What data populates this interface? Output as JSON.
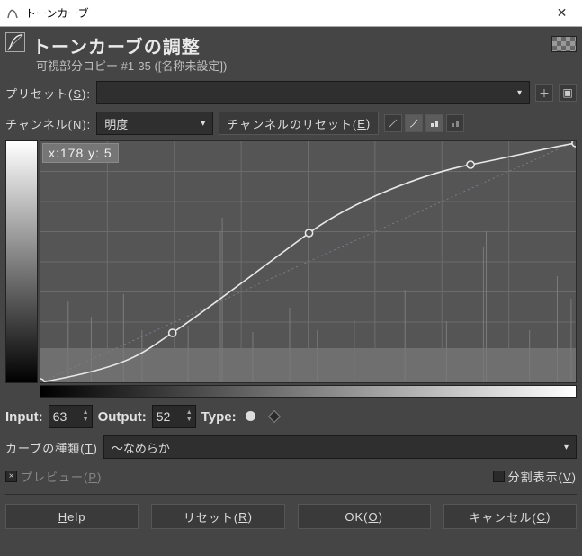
{
  "window": {
    "title": "トーンカーブ"
  },
  "header": {
    "title": "トーンカーブの調整",
    "subtitle": "可視部分コピー  #1-35 ([名称未設定])"
  },
  "preset": {
    "label_pre": "プリセット(",
    "label_u": "S",
    "label_post": "):",
    "value": ""
  },
  "channel": {
    "label_pre": "チャンネル(",
    "label_u": "N",
    "label_post": "):",
    "value": "明度",
    "reset_pre": "チャンネルのリセット(",
    "reset_u": "E",
    "reset_post": ")"
  },
  "curve": {
    "coord_label": "x:178 y:  5"
  },
  "io": {
    "input_label": "Input:",
    "input_value": "63",
    "output_label": "Output:",
    "output_value": "52",
    "type_label": "Type:"
  },
  "curve_type": {
    "label_pre": "カーブの種類(",
    "label_u": "T",
    "label_post": ")",
    "value": "〜なめらか"
  },
  "preview": {
    "pre": "プレビュー(",
    "u": "P",
    "post": ")"
  },
  "split": {
    "pre": "分割表示(",
    "u": "V",
    "post": ")"
  },
  "buttons": {
    "help_u": "H",
    "help_rest": "elp",
    "reset_pre": "リセット(",
    "reset_u": "R",
    "reset_post": ")",
    "ok_pre": "OK(",
    "ok_u": "O",
    "ok_post": ")",
    "cancel_pre": "キャンセル(",
    "cancel_u": "C",
    "cancel_post": ")"
  },
  "chart_data": {
    "type": "line",
    "title": "トーンカーブ",
    "xlabel": "Input",
    "ylabel": "Output",
    "xlim": [
      0,
      255
    ],
    "ylim": [
      0,
      255
    ],
    "series": [
      {
        "name": "identity",
        "x": [
          0,
          255
        ],
        "y": [
          0,
          255
        ]
      },
      {
        "name": "curve",
        "x": [
          0,
          63,
          128,
          205,
          255
        ],
        "y": [
          0,
          52,
          158,
          230,
          255
        ]
      }
    ],
    "cursor": {
      "x": 178,
      "y": 5
    }
  }
}
